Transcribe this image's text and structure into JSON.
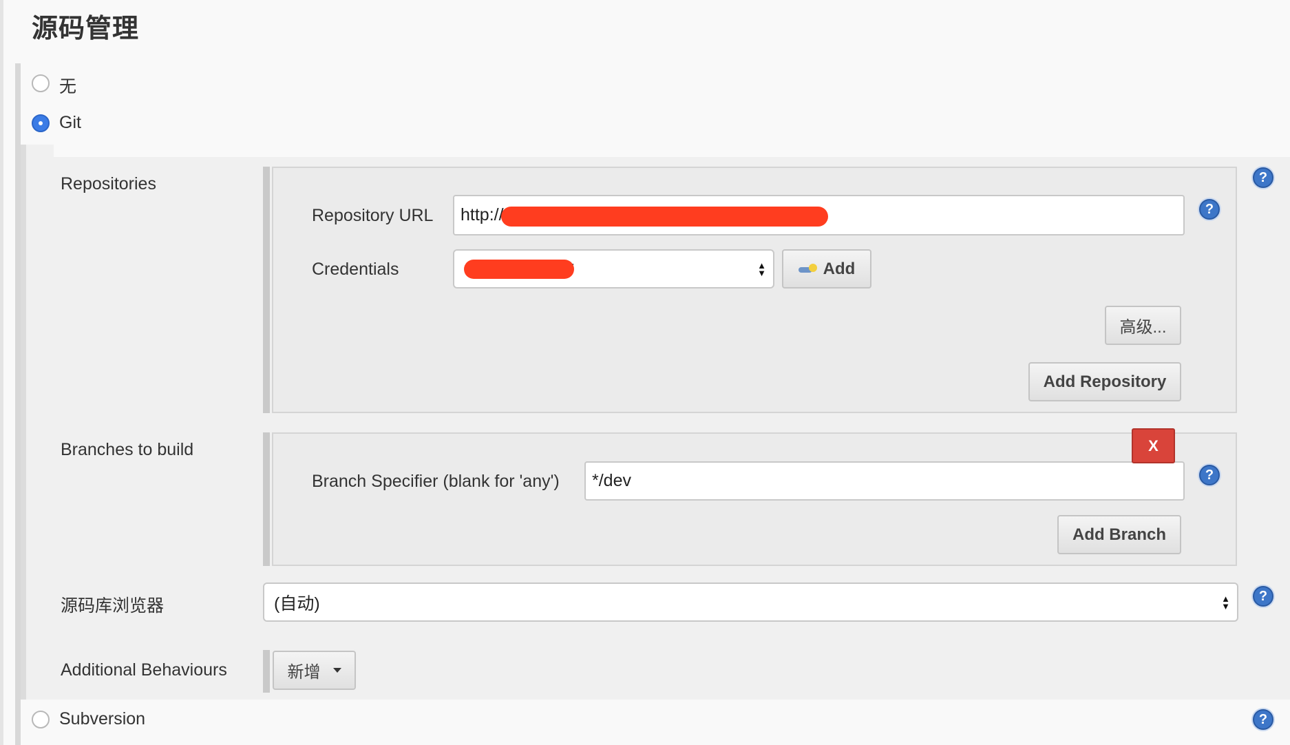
{
  "section": {
    "title": "源码管理"
  },
  "scm_options": {
    "none_label": "无",
    "git_label": "Git",
    "subversion_label": "Subversion",
    "selected": "Git"
  },
  "repositories": {
    "label": "Repositories",
    "url_label": "Repository URL",
    "url_value": "http://",
    "credentials_label": "Credentials",
    "credentials_value": "*",
    "add_credential_label": "Add",
    "advanced_label": "高级...",
    "add_repository_label": "Add Repository"
  },
  "branches": {
    "label": "Branches to build",
    "specifier_label": "Branch Specifier (blank for 'any')",
    "specifier_value": "*/dev",
    "delete_label": "X",
    "add_branch_label": "Add Branch"
  },
  "browser": {
    "label": "源码库浏览器",
    "value": "(自动)"
  },
  "behaviours": {
    "label": "Additional Behaviours",
    "add_label": "新增"
  },
  "help_glyph": "?",
  "colors": {
    "accent_radio": "#3b7ce6",
    "delete_button": "#d9443a",
    "help_icon": "#3d76c8",
    "redaction": "#ff3d1f"
  },
  "icons": [
    "help-icon",
    "key-icon",
    "select-arrows-icon",
    "caret-down-icon"
  ]
}
